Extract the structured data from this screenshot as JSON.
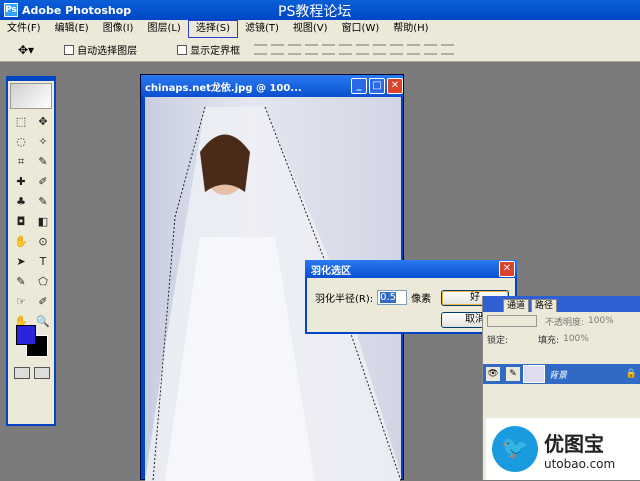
{
  "app": {
    "title": "Adobe Photoshop",
    "watermark": "PS教程论坛",
    "logo_letters": "Ps"
  },
  "menu": {
    "items": [
      "文件(F)",
      "编辑(E)",
      "图像(I)",
      "图层(L)",
      "选择(S)",
      "滤镜(T)",
      "视图(V)",
      "窗口(W)",
      "帮助(H)"
    ],
    "active_index": 4
  },
  "options": {
    "auto_select_layer": "自动选择图层",
    "show_bounding_box": "显示定界框"
  },
  "document": {
    "title": "chinaps.net龙依.jpg @ 100..."
  },
  "dialog": {
    "title": "羽化选区",
    "radius_label": "羽化半径(R):",
    "radius_value": "0.5",
    "unit": "像素",
    "ok": "好",
    "cancel": "取消"
  },
  "layers_panel": {
    "tabs": [
      "通道",
      "路径"
    ],
    "opacity_label": "不透明度:",
    "opacity_value": "100%",
    "lock_label": "锁定:",
    "fill_label": "填充:",
    "fill_value": "100%",
    "layer_name": "背景"
  },
  "tool_glyphs": [
    "⬚",
    "✥",
    "◌",
    "✧",
    "⌗",
    "✎",
    "✚",
    "✐",
    "♣",
    "✎",
    "◘",
    "◧",
    "✋",
    "⊙",
    "➤",
    "T",
    "✎",
    "⬠",
    "☞",
    "✐",
    "✋",
    "🔍"
  ],
  "brand": {
    "name": "优图宝",
    "url": "utobao.com"
  },
  "colors": {
    "foreground": "#2a25d8",
    "background": "#000000",
    "title_blue": "#0046c4"
  }
}
